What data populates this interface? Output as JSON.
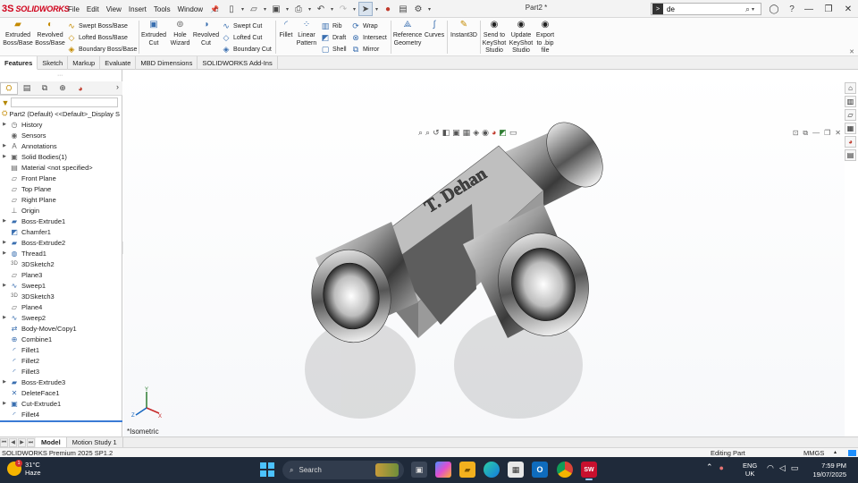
{
  "app": {
    "logo_glyph": "3S",
    "logo_text": "SOLIDWORKS",
    "document_title": "Part2 *"
  },
  "menu": [
    "File",
    "Edit",
    "View",
    "Insert",
    "Tools",
    "Window"
  ],
  "search": {
    "prefix": ">",
    "value": "de"
  },
  "ribbon": {
    "extruded_boss": "Extruded Boss/Base",
    "revolved_boss": "Revolved Boss/Base",
    "swept_boss": "Swept Boss/Base",
    "lofted_boss": "Lofted Boss/Base",
    "boundary_boss": "Boundary Boss/Base",
    "extruded_cut": "Extruded Cut",
    "hole_wizard": "Hole Wizard",
    "revolved_cut": "Revolved Cut",
    "swept_cut": "Swept Cut",
    "lofted_cut": "Lofted Cut",
    "boundary_cut": "Boundary Cut",
    "fillet": "Fillet",
    "linear_pattern": "Linear Pattern",
    "rib": "Rib",
    "draft": "Draft",
    "shell": "Shell",
    "wrap": "Wrap",
    "intersect": "Intersect",
    "mirror": "Mirror",
    "reference_geometry": "Reference Geometry",
    "curves": "Curves",
    "instant3d": "Instant3D",
    "send_keyshot": "Send to KeyShot Studio",
    "update_keyshot": "Update KeyShot Studio",
    "export_bip": "Export to .bip file"
  },
  "tabs": [
    "Features",
    "Sketch",
    "Markup",
    "Evaluate",
    "MBD Dimensions",
    "SOLIDWORKS Add-Ins"
  ],
  "tree": {
    "root": "Part2 (Default) <<Default>_Display S",
    "items": [
      {
        "label": "History",
        "expandable": true,
        "icon": "history-icon"
      },
      {
        "label": "Sensors",
        "expandable": false,
        "icon": "sensors-icon"
      },
      {
        "label": "Annotations",
        "expandable": true,
        "icon": "annotations-icon"
      },
      {
        "label": "Solid Bodies(1)",
        "expandable": true,
        "icon": "solid-bodies-icon"
      },
      {
        "label": "Material <not specified>",
        "expandable": false,
        "icon": "material-icon"
      },
      {
        "label": "Front Plane",
        "expandable": false,
        "icon": "plane-icon"
      },
      {
        "label": "Top Plane",
        "expandable": false,
        "icon": "plane-icon"
      },
      {
        "label": "Right Plane",
        "expandable": false,
        "icon": "plane-icon"
      },
      {
        "label": "Origin",
        "expandable": false,
        "icon": "origin-icon"
      },
      {
        "label": "Boss-Extrude1",
        "expandable": true,
        "icon": "boss-extrude-icon"
      },
      {
        "label": "Chamfer1",
        "expandable": false,
        "icon": "chamfer-icon"
      },
      {
        "label": "Boss-Extrude2",
        "expandable": true,
        "icon": "boss-extrude-icon"
      },
      {
        "label": "Thread1",
        "expandable": true,
        "icon": "thread-icon"
      },
      {
        "label": "3DSketch2",
        "expandable": false,
        "icon": "3dsketch-icon"
      },
      {
        "label": "Plane3",
        "expandable": false,
        "icon": "plane-icon"
      },
      {
        "label": "Sweep1",
        "expandable": true,
        "icon": "sweep-icon"
      },
      {
        "label": "3DSketch3",
        "expandable": false,
        "icon": "3dsketch-icon"
      },
      {
        "label": "Plane4",
        "expandable": false,
        "icon": "plane-icon"
      },
      {
        "label": "Sweep2",
        "expandable": true,
        "icon": "sweep-icon"
      },
      {
        "label": "Body-Move/Copy1",
        "expandable": false,
        "icon": "move-copy-icon"
      },
      {
        "label": "Combine1",
        "expandable": false,
        "icon": "combine-icon"
      },
      {
        "label": "Fillet1",
        "expandable": false,
        "icon": "fillet-icon"
      },
      {
        "label": "Fillet2",
        "expandable": false,
        "icon": "fillet-icon"
      },
      {
        "label": "Fillet3",
        "expandable": false,
        "icon": "fillet-icon"
      },
      {
        "label": "Boss-Extrude3",
        "expandable": true,
        "icon": "boss-extrude-icon"
      },
      {
        "label": "DeleteFace1",
        "expandable": false,
        "icon": "delete-face-icon"
      },
      {
        "label": "Cut-Extrude1",
        "expandable": true,
        "icon": "cut-extrude-icon"
      },
      {
        "label": "Fillet4",
        "expandable": false,
        "icon": "fillet-icon"
      }
    ]
  },
  "viewport": {
    "view_label": "*Isometric",
    "engraving": "T. Dehan",
    "triad": {
      "x": "X",
      "y": "Y",
      "z": "Z"
    }
  },
  "bottom_tabs": [
    "Model",
    "Motion Study 1"
  ],
  "status": {
    "product": "SOLIDWORKS Premium 2025 SP1.2",
    "mode": "Editing Part",
    "units": "MMGS"
  },
  "taskbar": {
    "weather_temp": "31°C",
    "weather_desc": "Haze",
    "weather_badge": "1",
    "search_label": "Search",
    "language_line1": "ENG",
    "language_line2": "UK",
    "time": "7:59 PM",
    "date": "19/07/2025",
    "sw_badge": "SW"
  },
  "colors": {
    "brand_red": "#d0021b",
    "selection_blue": "#3a7bd5",
    "taskbar": "#1f2a3a"
  }
}
